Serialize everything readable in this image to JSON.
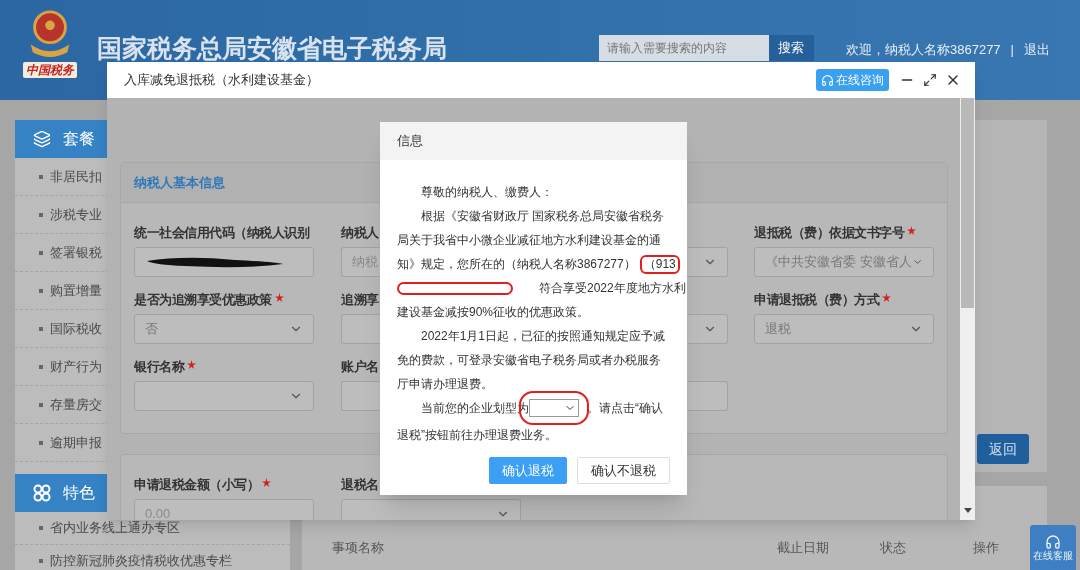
{
  "header": {
    "logo_text": "中国税务",
    "title": "国家税务总局安徽省电子税务局",
    "search": {
      "placeholder": "请输入需要搜索的内容",
      "button": "搜索"
    },
    "welcome": "欢迎，纳税人名称3867277",
    "separator": "|",
    "logout": "退出"
  },
  "sidebar": [
    {
      "title": "套餐",
      "items": [
        "非居民扣",
        "涉税专业",
        "签署银税",
        "购置增量",
        "国际税收",
        "财产行为",
        "存量房交",
        "逾期申报"
      ]
    },
    {
      "title": "特色",
      "items": [
        "省内业务线上通办专区",
        "防控新冠肺炎疫情税收优惠专栏"
      ]
    }
  ],
  "main": {
    "back_button": "返回",
    "columns": [
      "事项名称",
      "截止日期",
      "状态",
      "操作"
    ]
  },
  "float_button": "在线客服",
  "window": {
    "title": "入库减免退抵税（水利建设基金）",
    "consult_button": "在线咨询",
    "panels": [
      {
        "title": "纳税人基本信息",
        "rows": [
          [
            {
              "label": "统一社会信用代码（纳税人识别",
              "required": false,
              "kind": "redacted"
            },
            {
              "label": "纳税人",
              "required": false,
              "kind": "input",
              "placeholder": "纳税"
            },
            {
              "kind": "select"
            },
            {
              "label": "退抵税（费）依据文书字号",
              "required": true,
              "kind": "select",
              "value": "《中共安徽省委 安徽省人"
            }
          ],
          [
            {
              "label": "是否为追溯享受优惠政策",
              "required": true,
              "kind": "select",
              "value": "否"
            },
            {
              "label": "追溯享",
              "required": false,
              "kind": "select"
            },
            {
              "kind": "select"
            },
            {
              "label": "申请退抵税（费）方式",
              "required": true,
              "kind": "select",
              "value": "退税"
            }
          ],
          [
            {
              "label": "银行名称",
              "required": true,
              "kind": "select"
            },
            {
              "label": "账户名",
              "required": false,
              "kind": "input"
            },
            {
              "kind": "input"
            }
          ]
        ]
      },
      {
        "rows": [
          [
            {
              "label": "申请退税金额（小写）",
              "required": true,
              "kind": "input",
              "placeholder": "0.00"
            },
            {
              "label": "退税名",
              "required": false,
              "kind": "select"
            }
          ]
        ]
      }
    ]
  },
  "dialog": {
    "title": "信息",
    "greeting": "尊敬的纳税人、缴费人：",
    "notice_lines": [
      "根据《安徽省财政厅 国家税务总局安徽省税务",
      "局关于我省中小微企业减征地方水利建设基金的通",
      "知》规定，您所在的（纳税人名称3867277）"
    ],
    "circled_text": "（913",
    "after_redaction": "符合享受2022年度地方水利",
    "notice_last_line": "建设基金减按90%征收的优惠政策。",
    "refund_lines": [
      "2022年1月1日起，已征的按照通知规定应予减",
      "免的费款，可登录安徽省电子税务局或者办税服务",
      "厅申请办理退费。"
    ],
    "type_prefix": "当前您的企业划型为",
    "type_suffix_lines": [
      "。请点击“确认",
      "退税”按钮前往办理退费业务。"
    ],
    "buttons": [
      {
        "label": "确认退税",
        "primary": true
      },
      {
        "label": "确认不退税",
        "primary": false
      }
    ]
  }
}
